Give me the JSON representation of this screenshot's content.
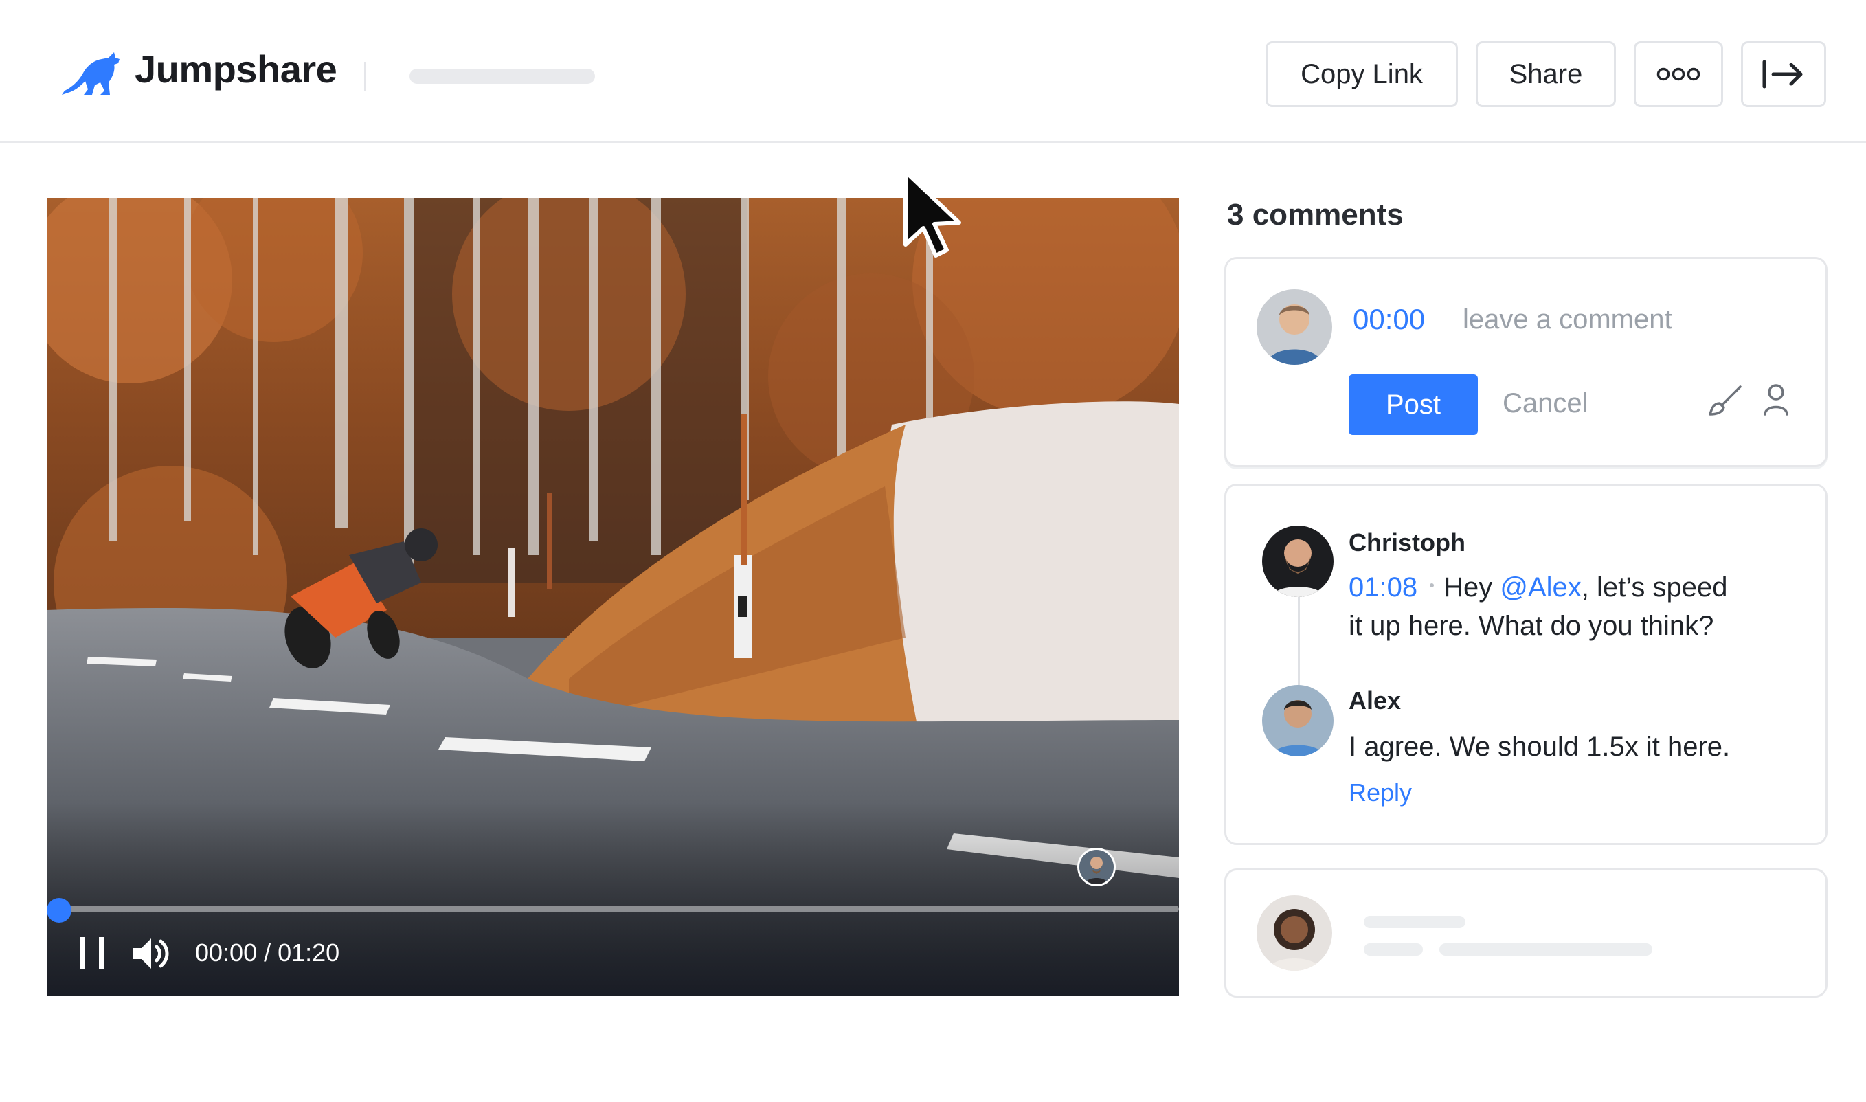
{
  "header": {
    "logo_text": "Jumpshare",
    "copy_link_label": "Copy Link",
    "share_label": "Share"
  },
  "player": {
    "time_display": "00:00 / 01:20",
    "progress": 0.0,
    "state": "playing"
  },
  "comments": {
    "count_label": "3 comments",
    "new_comment": {
      "timestamp": "00:00",
      "placeholder": "leave a comment",
      "post_label": "Post",
      "cancel_label": "Cancel"
    },
    "thread": [
      {
        "author": "Christoph",
        "timestamp": "01:08",
        "text_before": "Hey ",
        "mention": "@Alex",
        "text_after_line1": ", let’s speed",
        "text_line2": "it up here. What do you think?"
      },
      {
        "author": "Alex",
        "text": "I agree. We should 1.5x it here."
      }
    ],
    "reply_label": "Reply"
  },
  "colors": {
    "accent": "#2f7bff",
    "muted_text": "#9aa0a8",
    "border": "#e6e7ea"
  },
  "icons": [
    "kangaroo-logo-icon",
    "more-icon",
    "exit-icon",
    "pause-icon",
    "volume-icon",
    "brush-icon",
    "user-icon",
    "cursor-icon"
  ]
}
